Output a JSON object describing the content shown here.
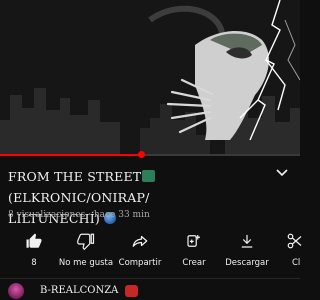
{
  "video": {
    "title": "FROM THE STREET",
    "title_rest": "(ELKRONIC/ONIRAP/",
    "title_line2": "LILTUNECHÍ)",
    "meta": "8 visualizaciones · hace 33 min",
    "progress_fraction": 0.47
  },
  "actions": [
    {
      "id": "like",
      "label": "8",
      "icon": "thumbs-up-filled-icon"
    },
    {
      "id": "dislike",
      "label": "No me gusta",
      "icon": "thumbs-down-icon"
    },
    {
      "id": "share",
      "label": "Compartir",
      "icon": "share-icon"
    },
    {
      "id": "remix",
      "label": "Crear",
      "icon": "create-remix-icon"
    },
    {
      "id": "download",
      "label": "Descargar",
      "icon": "download-icon"
    },
    {
      "id": "clip",
      "label": "Cl",
      "icon": "clip-icon"
    }
  ],
  "channel": {
    "name": "B-REALCONZA"
  },
  "colors": {
    "background": "#0f0f0f",
    "accent_red": "#ff0000",
    "text_primary": "#f1f1f1",
    "text_secondary": "#aaaaaa"
  }
}
